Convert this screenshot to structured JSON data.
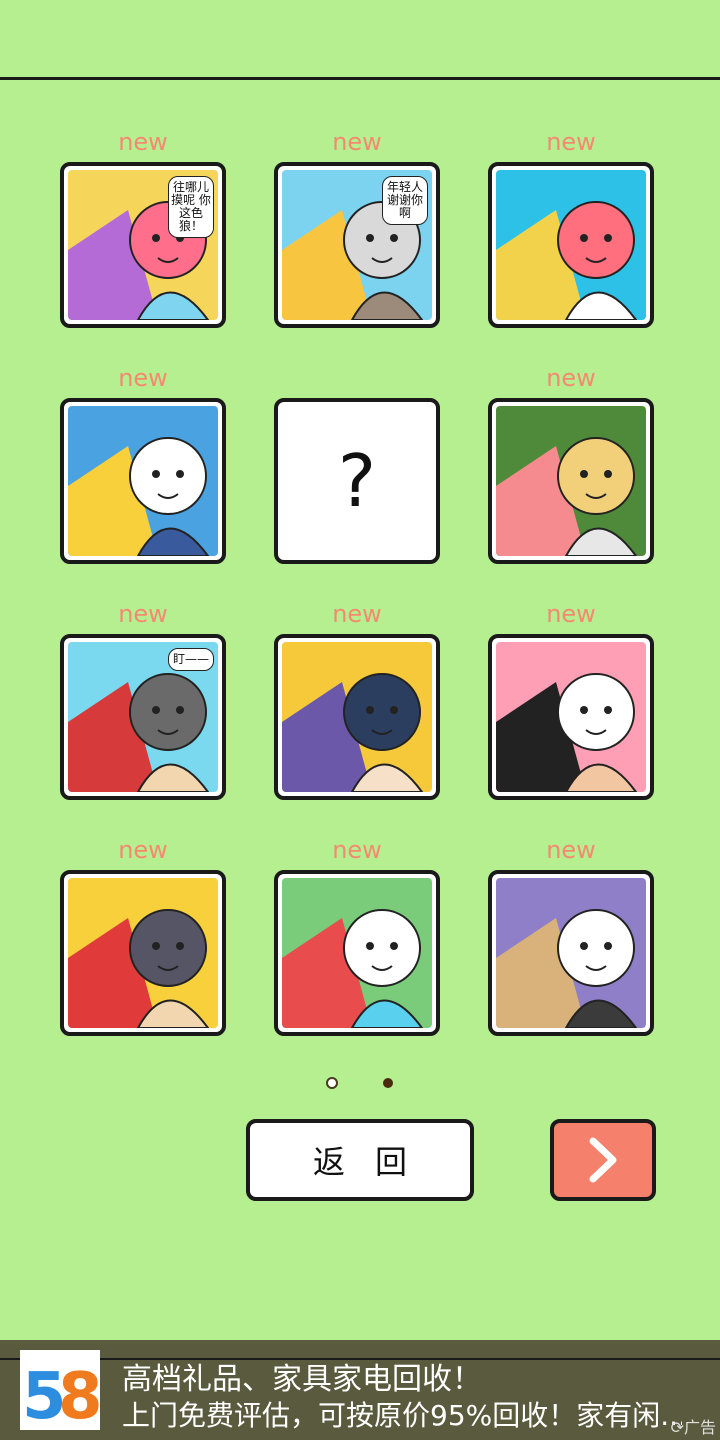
{
  "grid": {
    "new_label": "new",
    "cards": [
      {
        "new": true,
        "locked": false,
        "caption": "往哪儿摸呢 你这色狼！",
        "palette": [
          "#f6d55b",
          "#b56bd6",
          "#ff6e8a",
          "#7fd4f0"
        ]
      },
      {
        "new": true,
        "locked": false,
        "caption": "年轻人谢谢你啊",
        "palette": [
          "#7cd3ef",
          "#f7c540",
          "#d9d9d9",
          "#9c8a7a"
        ]
      },
      {
        "new": true,
        "locked": false,
        "caption": "",
        "palette": [
          "#2ec1e8",
          "#f2d24a",
          "#ff6f7e",
          "#ffffff"
        ]
      },
      {
        "new": true,
        "locked": false,
        "caption": "",
        "palette": [
          "#4aa2e0",
          "#f7d03c",
          "#ffffff",
          "#3a5a9e"
        ]
      },
      {
        "new": false,
        "locked": true,
        "caption": "?",
        "palette": [
          "#ffffff"
        ]
      },
      {
        "new": true,
        "locked": false,
        "caption": "",
        "palette": [
          "#4e8a3a",
          "#f58b8f",
          "#f2d07a",
          "#e7e7e7"
        ]
      },
      {
        "new": true,
        "locked": false,
        "caption": "盯——",
        "palette": [
          "#7ad8ef",
          "#d63a3a",
          "#6a6a6a",
          "#f2d6b0"
        ]
      },
      {
        "new": true,
        "locked": false,
        "caption": "",
        "palette": [
          "#f5c93a",
          "#6b58a8",
          "#2c3e60",
          "#f6e1c8"
        ]
      },
      {
        "new": true,
        "locked": false,
        "caption": "",
        "palette": [
          "#ff9fb6",
          "#222222",
          "#ffffff",
          "#f2c6a0"
        ]
      },
      {
        "new": true,
        "locked": false,
        "caption": "",
        "palette": [
          "#f7d03c",
          "#e03a3a",
          "#555566",
          "#f2d6b0"
        ]
      },
      {
        "new": true,
        "locked": false,
        "caption": "",
        "palette": [
          "#7acb7a",
          "#e84c4c",
          "#ffffff",
          "#5ad0ef"
        ]
      },
      {
        "new": true,
        "locked": false,
        "caption": "",
        "palette": [
          "#8e7fc8",
          "#d8b27a",
          "#ffffff",
          "#3b3b3b"
        ]
      }
    ]
  },
  "pager": {
    "current": 2,
    "total": 2
  },
  "buttons": {
    "back_label": "返回",
    "next_icon": "chevron-right-icon"
  },
  "ad": {
    "logo_text": "58",
    "title": "高档礼品、家具家电回收！",
    "subtitle": "上门免费评估，可按原价95%回收！家有闲...",
    "tag": "广告"
  },
  "colors": {
    "background": "#b5ef8f",
    "accent": "#f48a72",
    "next_button": "#f5806b"
  }
}
